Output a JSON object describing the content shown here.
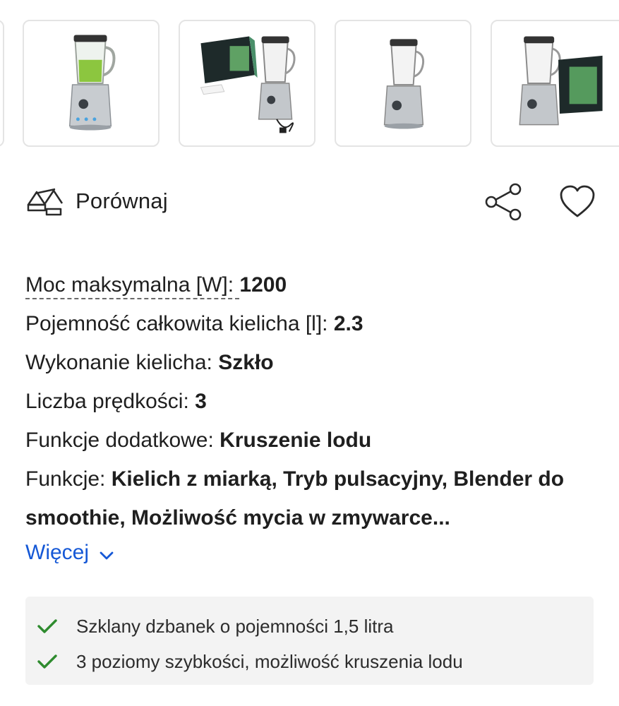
{
  "gallery": {
    "thumbnails": [
      {
        "alt": "blender-green-smoothie"
      },
      {
        "alt": "blender-with-box-and-cable"
      },
      {
        "alt": "blender-front-empty"
      },
      {
        "alt": "blender-with-box"
      }
    ]
  },
  "actions": {
    "compare_label": "Porównaj",
    "compare_icon": "scales-icon",
    "share_icon": "share-icon",
    "favorite_icon": "heart-icon"
  },
  "specs": [
    {
      "key": "Moc maksymalna [W]: ",
      "value": "1200"
    },
    {
      "key": "Pojemność całkowita kielicha [l]: ",
      "value": "2.3"
    },
    {
      "key": "Wykonanie kielicha: ",
      "value": "Szkło"
    },
    {
      "key": "Liczba prędkości: ",
      "value": "3"
    },
    {
      "key": "Funkcje dodatkowe: ",
      "value": "Kruszenie lodu"
    },
    {
      "key": "Funkcje: ",
      "value": "Kielich z miarką, Tryb pulsacyjny, Blender do smoothie, Możliwość mycia w zmywarce..."
    }
  ],
  "more": {
    "label": "Więcej",
    "icon": "chevron-down-icon"
  },
  "highlights": [
    {
      "text": "Szklany dzbanek o pojemności 1,5 litra",
      "icon": "check-icon"
    },
    {
      "text": "3 poziomy szybkości, możliwość kruszenia lodu",
      "icon": "check-icon"
    }
  ],
  "colors": {
    "link": "#1558d6",
    "check": "#2e8b2e",
    "highlight_bg": "#f3f3f3",
    "thumb_border": "#e4e4e4"
  }
}
